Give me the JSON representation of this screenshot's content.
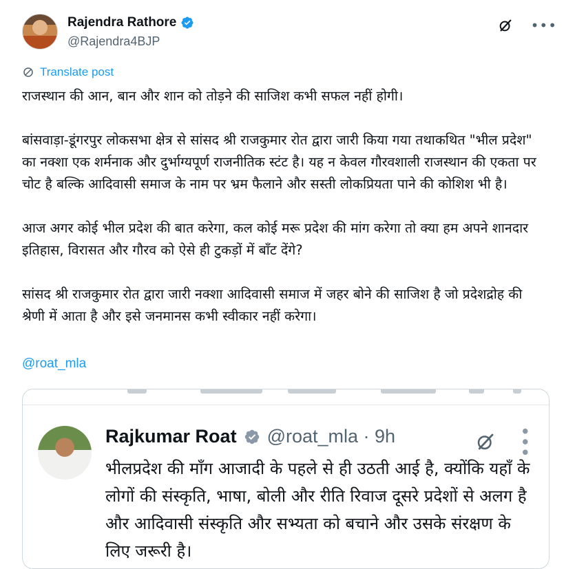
{
  "post": {
    "author_name": "Rajendra Rathore",
    "author_handle": "@Rajendra4BJP",
    "translate_label": "Translate post",
    "paragraphs": [
      "राजस्थान की आन, बान और शान को तोड़ने की साजिश कभी सफल नहीं होगी।",
      "बांसवाड़ा-डूंगरपुर लोकसभा क्षेत्र से सांसद श्री राजकुमार रोत द्वारा जारी किया गया तथाकथित \"भील प्रदेश\" का नक्शा एक शर्मनाक और दुर्भाग्यपूर्ण राजनीतिक स्टंट है। यह न केवल गौरवशाली राजस्थान की एकता पर चोट है बल्कि आदिवासी समाज के नाम पर भ्रम फैलाने और सस्ती लोकप्रियता पाने की कोशिश भी है।",
      "आज अगर कोई भील प्रदेश की बात करेगा, कल कोई मरू प्रदेश की मांग करेगा तो क्या हम अपने शानदार इतिहास, विरासत और गौरव को ऐसे ही टुकड़ों में बाँट देंगे?",
      "सांसद श्री राजकुमार रोत द्वारा जारी नक्शा आदिवासी समाज में जहर बोने की साजिश है जो प्रदेशद्रोह की श्रेणी में आता है और इसे जनमानस कभी स्वीकार नहीं करेगा।"
    ],
    "mention": "@roat_mla"
  },
  "embedded": {
    "author_name": "Rajkumar Roat",
    "handle_time": "@roat_mla · 9h",
    "text": "भीलप्रदेश की माँग आजादी के पहले से ही उठती आई है, क्योंकि यहाँ के लोगों की संस्कृति, भाषा, बोली और रीति रिवाज दूसरे प्रदेशों से अलग है और आदिवासी संस्कृति और सभ्यता को बचाने और उसके संरक्षण के लिए जरूरी है।"
  },
  "icons": {
    "verified": "verified-badge-icon",
    "grok": "grok-icon",
    "more": "more-icon",
    "translate": "translate-icon"
  },
  "colors": {
    "accent": "#1d9bf0",
    "text": "#0f1419",
    "secondary": "#536471",
    "border": "#cfd9de"
  }
}
